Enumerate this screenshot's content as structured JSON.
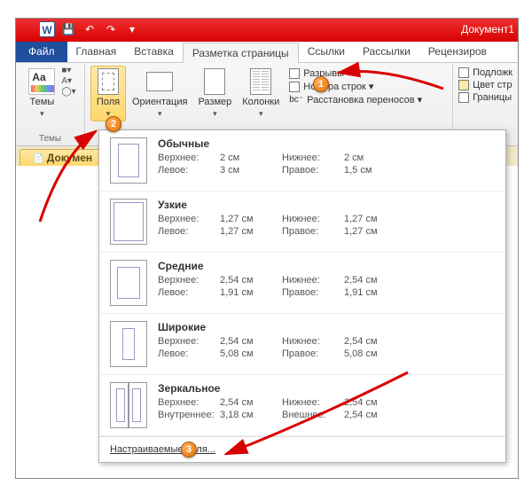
{
  "title_bar": {
    "document_name": "Документ1",
    "word_letter": "W",
    "save_glyph": "💾",
    "undo_glyph": "↶",
    "redo_glyph": "↷",
    "more_glyph": "▾"
  },
  "tabs": {
    "file": "Файл",
    "home": "Главная",
    "insert": "Вставка",
    "page_layout": "Разметка страницы",
    "references": "Ссылки",
    "mailings": "Рассылки",
    "review": "Рецензиров"
  },
  "ribbon": {
    "themes": {
      "label": "Темы",
      "button": "Темы",
      "aa": "Aa",
      "mini1": "■▾",
      "mini2": "A▾",
      "mini3": "◯▾"
    },
    "margins": {
      "label": "Поля"
    },
    "orientation": {
      "label": "Ориентация"
    },
    "size": {
      "label": "Размер"
    },
    "columns": {
      "label": "Колонки"
    },
    "breaks": "Разрывы ▾",
    "line_numbers": "Номера строк ▾",
    "hyphenation": "Расстановка переносов ▾",
    "watermark": "Подложк",
    "page_color": "Цвет стр",
    "borders": "Границы"
  },
  "doc_tab": "Докумен",
  "margins_gallery": {
    "items": [
      {
        "name": "Обычные",
        "top_label": "Верхнее:",
        "top": "2 см",
        "bottom_label": "Нижнее:",
        "bottom": "2 см",
        "left_label": "Левое:",
        "left": "3 см",
        "right_label": "Правое:",
        "right": "1,5 см",
        "thumb": "normal"
      },
      {
        "name": "Узкие",
        "top_label": "Верхнее:",
        "top": "1,27 см",
        "bottom_label": "Нижнее:",
        "bottom": "1,27 см",
        "left_label": "Левое:",
        "left": "1,27 см",
        "right_label": "Правое:",
        "right": "1,27 см",
        "thumb": "narrow"
      },
      {
        "name": "Средние",
        "top_label": "Верхнее:",
        "top": "2,54 см",
        "bottom_label": "Нижнее:",
        "bottom": "2,54 см",
        "left_label": "Левое:",
        "left": "1,91 см",
        "right_label": "Правое:",
        "right": "1,91 см",
        "thumb": "medium"
      },
      {
        "name": "Широкие",
        "top_label": "Верхнее:",
        "top": "2,54 см",
        "bottom_label": "Нижнее:",
        "bottom": "2,54 см",
        "left_label": "Левое:",
        "left": "5,08 см",
        "right_label": "Правое:",
        "right": "5,08 см",
        "thumb": "wide"
      },
      {
        "name": "Зеркальное",
        "top_label": "Верхнее:",
        "top": "2,54 см",
        "bottom_label": "Нижнее:",
        "bottom": "2,54 см",
        "left_label": "Внутреннее:",
        "left": "3,18 см",
        "right_label": "Внешнее:",
        "right": "2,54 см",
        "thumb": "mirror"
      }
    ],
    "custom": "Настраиваемые поля..."
  },
  "callouts": {
    "n1": "1",
    "n2": "2",
    "n3": "3"
  }
}
